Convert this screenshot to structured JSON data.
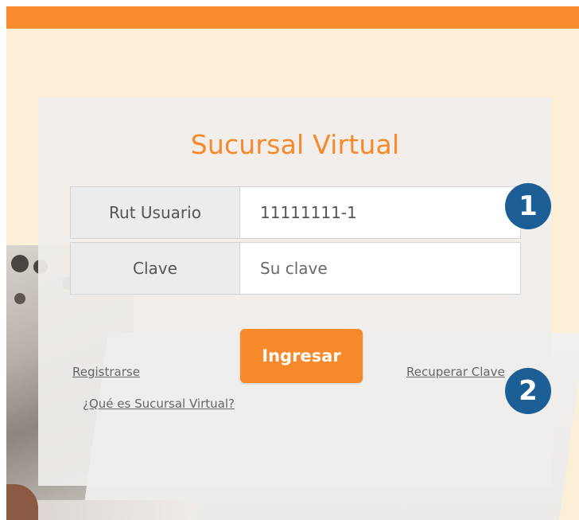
{
  "theme": {
    "accent": "#fb8d2e",
    "title_color": "#f7892a",
    "badge_color": "#1c5f96",
    "page_background": "#fcefd8"
  },
  "login": {
    "title": "Sucursal Virtual",
    "rut_label": "Rut Usuario",
    "rut_value": "11111111-1",
    "clave_label": "Clave",
    "clave_placeholder": "Su clave",
    "submit_label": "Ingresar",
    "register_link": "Registrarse",
    "recover_link": "Recuperar Clave",
    "about_link": "¿Qué es Sucursal Virtual?"
  },
  "badges": {
    "step_1": "1",
    "step_2": "2"
  }
}
